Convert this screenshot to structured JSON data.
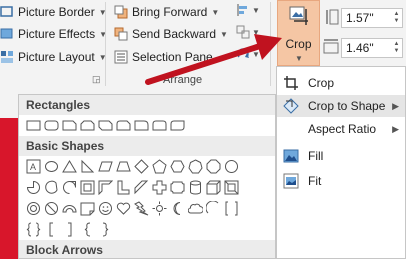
{
  "ribbon": {
    "picture_border": "Picture Border",
    "picture_effects": "Picture Effects",
    "picture_layout": "Picture Layout",
    "bring_forward": "Bring Forward",
    "send_backward": "Send Backward",
    "selection_pane": "Selection Pane",
    "arrange_label": "Arrange",
    "crop_label": "Crop",
    "height_value": "1.57\"",
    "width_value": "1.46\""
  },
  "gallery": {
    "categories": [
      "Rectangles",
      "Basic Shapes",
      "Block Arrows"
    ]
  },
  "crop_menu": {
    "items": [
      "Crop",
      "Crop to Shape",
      "Aspect Ratio",
      "Fill",
      "Fit"
    ]
  },
  "colors": {
    "accent": "#f5c6a4",
    "arrow": "#c0121f",
    "slide": "#d8162b"
  }
}
